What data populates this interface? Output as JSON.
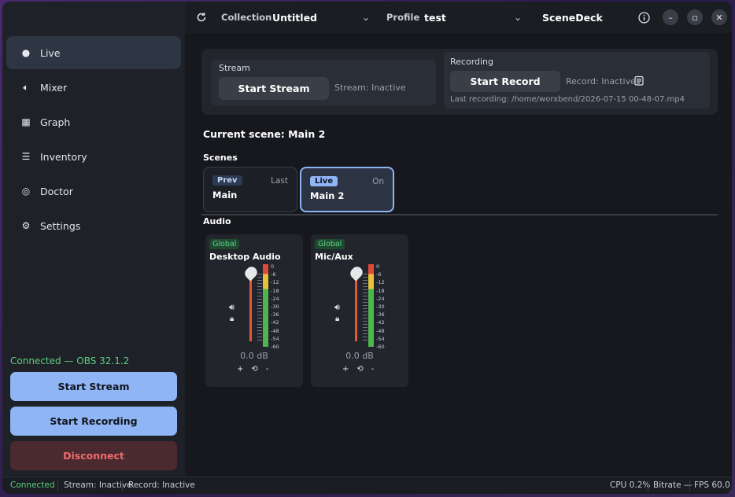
{
  "sidebar": {
    "items": [
      {
        "label": "Live",
        "icon": "dot-icon"
      },
      {
        "label": "Mixer",
        "icon": "speaker-icon"
      },
      {
        "label": "Graph",
        "icon": "grid-icon"
      },
      {
        "label": "Inventory",
        "icon": "list-icon"
      },
      {
        "label": "Doctor",
        "icon": "check-circle-icon"
      },
      {
        "label": "Settings",
        "icon": "gear-icon"
      }
    ],
    "connection": "Connected — OBS 32.1.2",
    "start_stream": "Start Stream",
    "start_recording": "Start Recording",
    "disconnect": "Disconnect"
  },
  "titlebar": {
    "collection_label": "Collection",
    "collection_value": "Untitled",
    "profile_label": "Profile",
    "profile_value": "test",
    "app_name": "SceneDeck"
  },
  "stream": {
    "title": "Stream",
    "button": "Start Stream",
    "status": "Stream: Inactive"
  },
  "recording": {
    "title": "Recording",
    "button": "Start Record",
    "status": "Record: Inactive",
    "last": "Last recording: /home/worxbend/2026-07-15 00-48-07.mp4"
  },
  "current_scene": "Current scene: Main 2",
  "scenes_title": "Scenes",
  "scenes": [
    {
      "badge": "Prev",
      "tag": "Last",
      "name": "Main"
    },
    {
      "badge": "Live",
      "tag": "On",
      "name": "Main 2"
    }
  ],
  "audio_title": "Audio",
  "audio": [
    {
      "badge": "Global",
      "name": "Desktop Audio",
      "db": "0.0 dB"
    },
    {
      "badge": "Global",
      "name": "Mic/Aux",
      "db": "0.0 dB"
    }
  ],
  "meter_scale": [
    "0",
    "-6",
    "-12",
    "-18",
    "-24",
    "-30",
    "-36",
    "-42",
    "-48",
    "-54",
    "-60"
  ],
  "mixer_controls": {
    "plus": "+",
    "reset": "⟲",
    "minus": "-"
  },
  "statusbar": {
    "connected": "Connected",
    "stream": "Stream: Inactive",
    "record": "Record: Inactive",
    "cpu": "CPU 0.2%",
    "bitrate": "Bitrate —",
    "fps": "FPS 60.0"
  },
  "colors": {
    "accent": "#8fb5f5",
    "connected": "#5fcf7e",
    "danger": "#f06b6b",
    "meter_red": "#e04a3a",
    "meter_yellow": "#e8c03a",
    "meter_green": "#4cb84c"
  }
}
